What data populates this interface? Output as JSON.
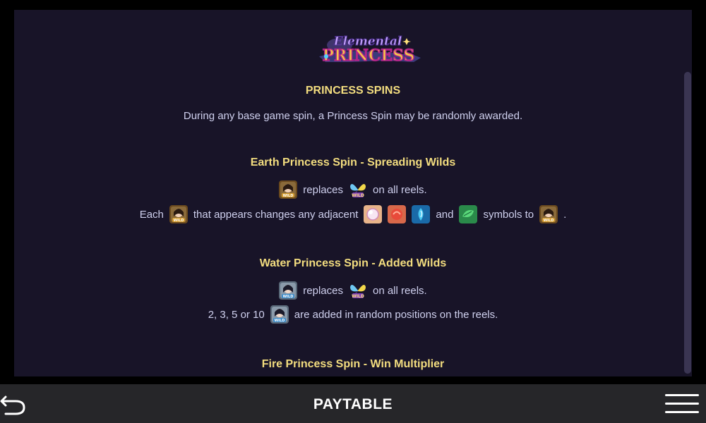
{
  "logo": {
    "line1": "Elemental",
    "line2": "PRINCESS"
  },
  "sections": {
    "princess_spins": {
      "heading": "PRINCESS SPINS",
      "text": "During any base game spin, a Princess Spin may be randomly awarded."
    },
    "earth": {
      "heading": "Earth Princess Spin - Spreading Wilds",
      "line1_replaces": "replaces",
      "line1_tail": "on all reels.",
      "line2_each": "Each",
      "line2_mid": "that appears changes any adjacent",
      "line2_and": "and",
      "line2_symbols_to": "symbols to",
      "line2_end": "."
    },
    "water": {
      "heading": "Water Princess Spin - Added Wilds",
      "line1_replaces": "replaces",
      "line1_tail": "on all reels.",
      "line2_head": "2, 3, 5 or 10",
      "line2_tail": "are added in random positions on the reels."
    },
    "fire": {
      "heading": "Fire Princess Spin - Win Multiplier"
    }
  },
  "symbols": {
    "earth_wild": "earth-princess-wild-symbol-icon",
    "water_wild": "water-princess-wild-symbol-icon",
    "wild": "butterfly-wild-symbol-icon",
    "pearl": "pearl-symbol-icon",
    "ruby": "ruby-symbol-icon",
    "sapphire": "sapphire-symbol-icon",
    "emerald": "emerald-symbol-icon"
  },
  "bottom_bar": {
    "title": "PAYTABLE",
    "back_icon": "back-arrow-icon",
    "menu_icon": "hamburger-menu-icon"
  },
  "colors": {
    "panel_bg": "#181428",
    "heading": "#f3dd7f",
    "body_text": "#cfd0ee",
    "bar_bg": "#262629"
  }
}
